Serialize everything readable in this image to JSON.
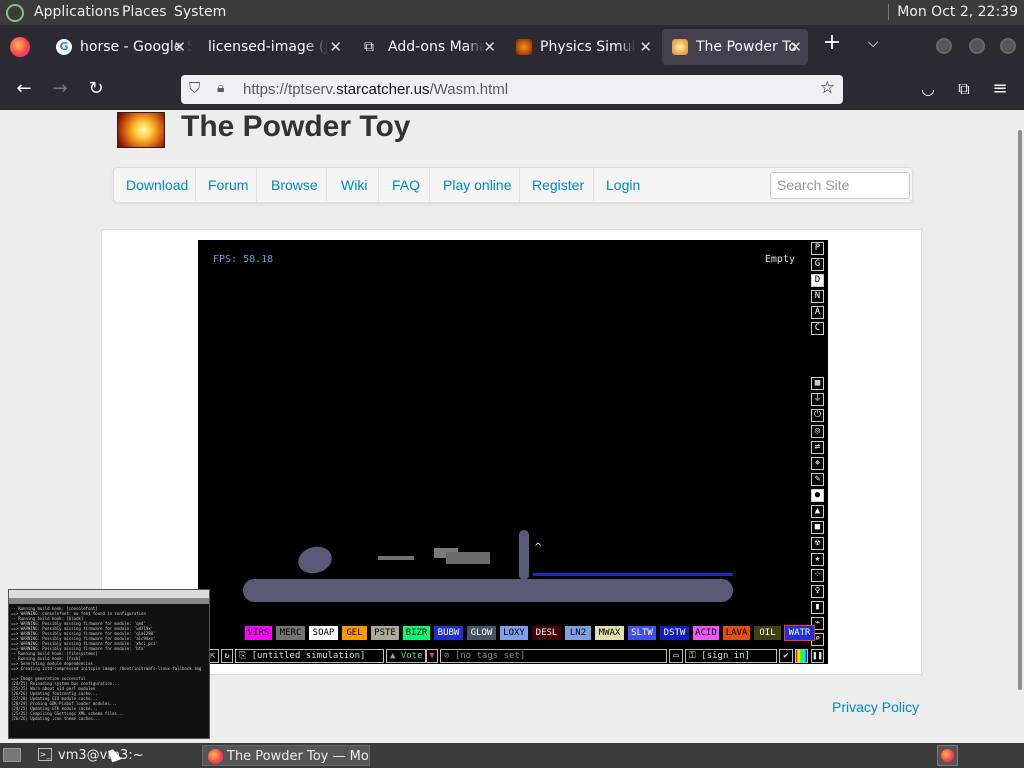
{
  "topbar": {
    "menus": [
      "Applications",
      "Places",
      "System"
    ],
    "clock": "Mon Oct  2, 22:39"
  },
  "tabs": [
    {
      "label": "horse - Google Search",
      "icon": "google-icon",
      "active": false
    },
    {
      "label": "licensed-image (JPEG Image)",
      "icon": "",
      "active": false
    },
    {
      "label": "Add-ons Manager",
      "icon": "puzzle-icon",
      "active": false
    },
    {
      "label": "Physics Simulation",
      "icon": "simulation-icon",
      "active": false
    },
    {
      "label": "The Powder Toy",
      "icon": "powder-toy-icon",
      "active": true
    }
  ],
  "url": {
    "prefix": "https://tptserv.",
    "domain": "starcatcher.us",
    "path": "/Wasm.html"
  },
  "site": {
    "title": "The Powder Toy",
    "menu": [
      "Download",
      "Forum",
      "Browse",
      "Wiki",
      "FAQ",
      "Play online",
      "Register",
      "Login"
    ],
    "search_placeholder": "Search Site",
    "privacy": "Privacy Policy"
  },
  "game": {
    "fps": "FPS: 58.18",
    "status": "Empty",
    "top_buttons": [
      "P",
      "G",
      "D",
      "N",
      "A",
      "C"
    ],
    "elements": [
      {
        "label": "VIRS",
        "bg": "#ff00ff",
        "fg": "#000000"
      },
      {
        "label": "MERC",
        "bg": "#737373",
        "fg": "#000000"
      },
      {
        "label": "SOAP",
        "bg": "#ffffff",
        "fg": "#000000"
      },
      {
        "label": "GEL",
        "bg": "#ff9900",
        "fg": "#000000"
      },
      {
        "label": "PSTE",
        "bg": "#aaaa99",
        "fg": "#000000"
      },
      {
        "label": "BIZR",
        "bg": "#00ff77",
        "fg": "#000000"
      },
      {
        "label": "BUBW",
        "bg": "#2030d0",
        "fg": "#ffffff"
      },
      {
        "label": "GLOW",
        "bg": "#445464",
        "fg": "#ffffff"
      },
      {
        "label": "LOXY",
        "bg": "#80a0ef",
        "fg": "#000000"
      },
      {
        "label": "DESL",
        "bg": "#440000",
        "fg": "#ffffff"
      },
      {
        "label": "LN2",
        "bg": "#80a0df",
        "fg": "#000000"
      },
      {
        "label": "MWAX",
        "bg": "#e0e0aa",
        "fg": "#000000"
      },
      {
        "label": "SLTW",
        "bg": "#4050f0",
        "fg": "#ffffff"
      },
      {
        "label": "DSTW",
        "bg": "#1020c0",
        "fg": "#ffffff"
      },
      {
        "label": "ACID",
        "bg": "#ed55ff",
        "fg": "#000000"
      },
      {
        "label": "LAVA",
        "bg": "#e05010",
        "fg": "#000000"
      },
      {
        "label": "OIL",
        "bg": "#404010",
        "fg": "#ffffff"
      },
      {
        "label": "WATR",
        "bg": "#2030d0",
        "fg": "#ffffff"
      }
    ],
    "sim_name": "[untitled simulation]",
    "vote_label": "Vote",
    "tags": "[no tags set]",
    "signin": "[sign in]"
  },
  "terminal": {
    "lines": [
      "-- Running build hook: [consolefont]",
      "==> WARNING: consolefont: no font found in configuration",
      "-- Running build hook: [block]",
      "==> WARNING: Possibly missing firmware for module: 'qed'",
      "==> WARNING: Possibly missing firmware for module: 'wd719x'",
      "==> WARNING: Possibly missing firmware for module: 'qla1280'",
      "==> WARNING: Possibly missing firmware for module: 'aic94xx'",
      "==> WARNING: Possibly missing firmware for module: 'xhci_pci'",
      "==> WARNING: Possibly missing firmware for module: 'bfa'",
      "-- Running build hook: [filesystems]",
      "-- Running build hook: [fsck]",
      "==> Generating module dependencies",
      "==> Creating zstd-compressed initcpio image: /boot/initramfs-linux-fallback.img",
      "",
      "==> Image generation successful",
      "(24/25) Reloading system bus configuration...",
      "(25/25) Warn about old perl modules",
      "(26/26) Updating fontconfig cache...",
      "(27/28) Updating GIO module cache...",
      "(28/29) Probing GDK-Pixbuf loader modules...",
      "(24/25) Updating GTK module cache...",
      "(25/25) Compiling GSettings XML schema files...",
      "(26/26) Updating icon theme caches..."
    ]
  },
  "taskbar": {
    "items": [
      "vm3@vm3:~",
      "The Powder Toy — Mozilla Firefox"
    ]
  }
}
